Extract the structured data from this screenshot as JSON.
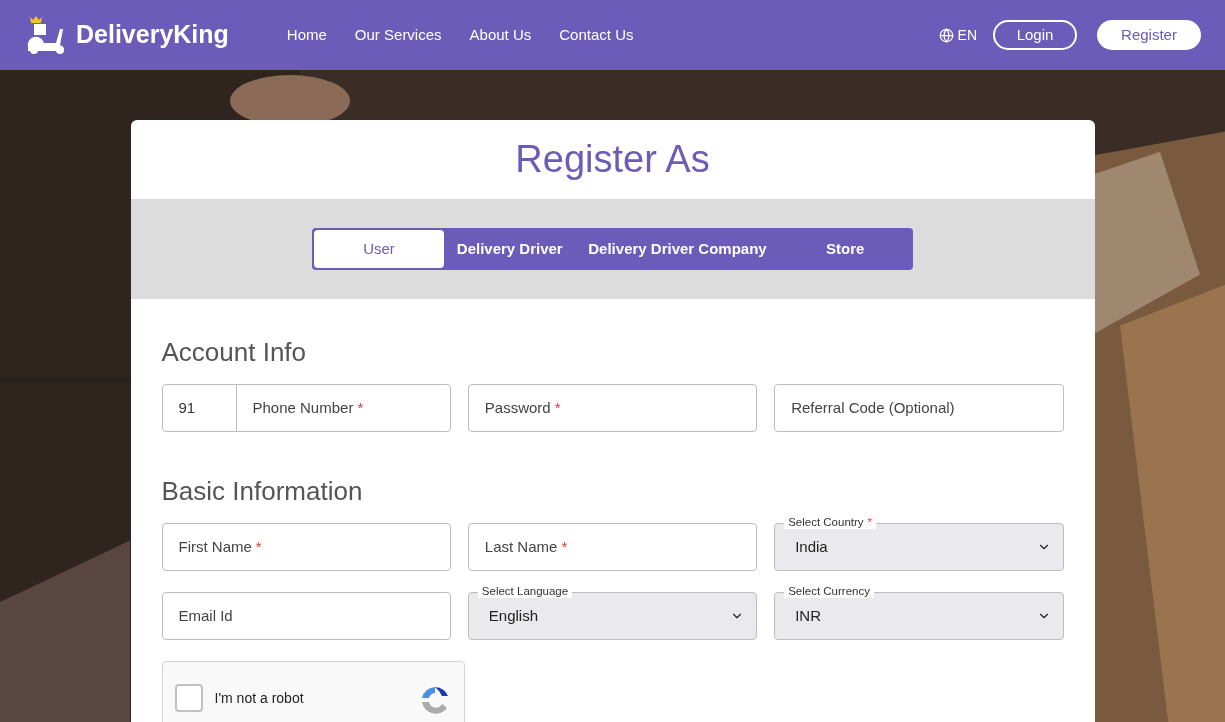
{
  "header": {
    "brand": "DeliveryKing",
    "nav": [
      {
        "label": "Home"
      },
      {
        "label": "Our Services"
      },
      {
        "label": "About Us"
      },
      {
        "label": "Contact Us"
      }
    ],
    "language": "EN",
    "login": "Login",
    "register": "Register"
  },
  "card": {
    "title": "Register As",
    "tabs": [
      {
        "label": "User",
        "selected": true
      },
      {
        "label": "Delivery Driver",
        "selected": false
      },
      {
        "label": "Delivery Driver Company",
        "selected": false
      },
      {
        "label": "Store",
        "selected": false
      }
    ],
    "sections": [
      {
        "heading": "Account Info",
        "fields": [
          {
            "kind": "phone",
            "code": "91",
            "label": "Phone Number",
            "required_mark": "*"
          },
          {
            "kind": "input",
            "label": "Password",
            "required_mark": "*"
          },
          {
            "kind": "input",
            "label": "Referral Code (Optional)"
          }
        ]
      },
      {
        "heading": "Basic Information",
        "fields": [
          {
            "kind": "input",
            "label": "First Name",
            "required_mark": "*"
          },
          {
            "kind": "input",
            "label": "Last Name",
            "required_mark": "*"
          },
          {
            "kind": "select",
            "label": "Select Country",
            "value": "India",
            "required_mark": "*"
          },
          {
            "kind": "input",
            "label": "Email Id"
          },
          {
            "kind": "select",
            "label": "Select Language",
            "value": "English"
          },
          {
            "kind": "select",
            "label": "Select Currency",
            "value": "INR"
          }
        ]
      }
    ],
    "captcha": {
      "label": "I'm not a robot",
      "checked": false
    }
  }
}
